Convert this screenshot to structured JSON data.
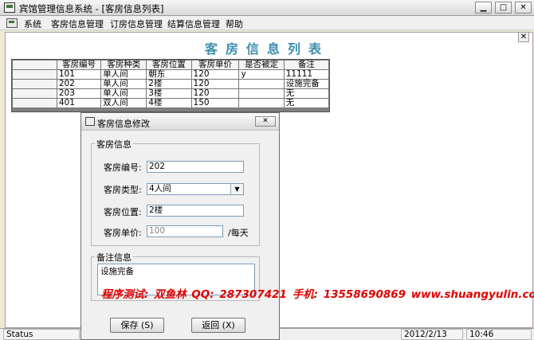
{
  "window": {
    "title": "宾馆管理信息系统 - [客房信息列表]",
    "minimize_glyph": "▁",
    "maximize_glyph": "□",
    "close_glyph": "✕",
    "mdi_close_glyph": "✕"
  },
  "menu": {
    "items": [
      "系统",
      "客房信息管理",
      "订房信息管理",
      "结算信息管理",
      "帮助"
    ]
  },
  "list": {
    "heading": "客房信息列表",
    "columns": [
      "客房编号",
      "客房种类",
      "客房位置",
      "客房单价",
      "是否被定",
      "备注"
    ],
    "rows": [
      [
        "101",
        "单人间",
        "朝东",
        "120",
        "y",
        "11111"
      ],
      [
        "202",
        "单人间",
        "2楼",
        "120",
        "",
        "设施完备"
      ],
      [
        "203",
        "单人间",
        "3楼",
        "120",
        "",
        "无"
      ],
      [
        "401",
        "双人间",
        "4楼",
        "150",
        "",
        "无"
      ]
    ]
  },
  "dialog": {
    "title": "客房信息修改",
    "close_glyph": "✕",
    "room_group": "客房信息",
    "fields": {
      "room_no": {
        "label": "客房编号:",
        "value": "202"
      },
      "room_type": {
        "label": "客房类型:",
        "value": "4人间",
        "arrow": "▼"
      },
      "room_position": {
        "label": "客房位置:",
        "value": "2楼"
      },
      "room_price": {
        "label": "客房单价:",
        "value": "100",
        "unit": "/每天"
      }
    },
    "remark_group": "备注信息",
    "remark_value": "设施完备",
    "save_button": "保存 (S)",
    "back_button": "返回 (X)"
  },
  "watermark": "程序测试: 双鱼林   QQ: 287307421   手机: 13558690869   www.shuangyulin.com",
  "status": {
    "text": "Status",
    "date": "2012/2/13",
    "time": "10:46"
  },
  "colors": {
    "heading": "#3d8fb0",
    "watermark": "#e00000"
  }
}
